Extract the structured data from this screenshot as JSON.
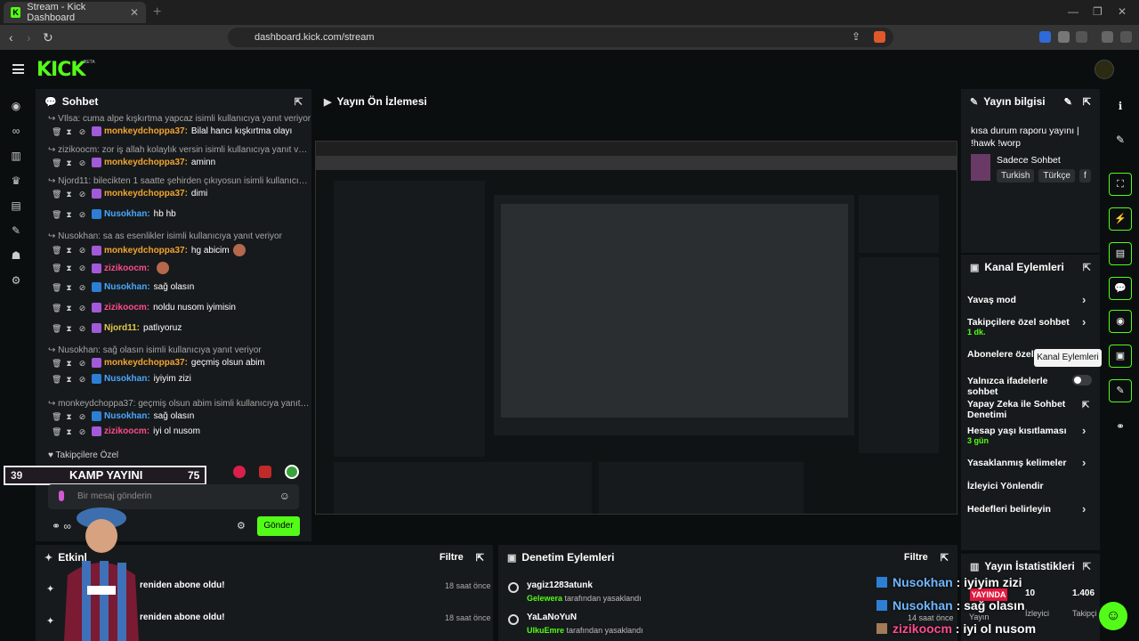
{
  "browser": {
    "tab_title": "Stream - Kick Dashboard",
    "url": "dashboard.kick.com/stream"
  },
  "app": {
    "logo": "KICK",
    "beta": "BETA"
  },
  "chat": {
    "title": "Sohbet",
    "lines": [
      {
        "reply": "VIlsa: cuma alpe kışkırtma yapcaz isimli kullanıcıya yanıt veriyor",
        "user": "monkeydchoppa37",
        "text": "Bilal hancı kışkırtma olayı",
        "color": "#f3a42f"
      },
      {
        "reply": "zizikoocm: zor iş allah kolaylık versin isimli kullanıcıya yanıt veriyor",
        "user": "monkeydchoppa37",
        "text": "aminn",
        "color": "#f3a42f"
      },
      {
        "reply": "Njord11: bilecikten 1 saatte şehirden çıkıyosun isimli kullanıcıya yanıt ...",
        "user": "monkeydchoppa37",
        "text": "dimi",
        "color": "#f3a42f"
      },
      {
        "reply": "",
        "user": "Nusokhan",
        "text": "hb hb",
        "color": "#4aa8ff"
      },
      {
        "reply": "Nusokhan: sa as esenlikler isimli kullanıcıya yanıt veriyor",
        "user": "monkeydchoppa37",
        "text": "hg abicim",
        "color": "#f3a42f"
      },
      {
        "reply": "",
        "user": "zizikoocm",
        "text": "",
        "color": "#ff4c8b"
      },
      {
        "reply": "",
        "user": "Nusokhan",
        "text": "sağ olasın",
        "color": "#4aa8ff"
      },
      {
        "reply": "",
        "user": "zizikoocm",
        "text": "noldu nusom iyimisin",
        "color": "#ff4c8b"
      },
      {
        "reply": "",
        "user": "Njord11",
        "text": "patlıyoruz",
        "color": "#e6c84a"
      },
      {
        "reply": "Nusokhan: sağ olasın isimli kullanıcıya yanıt veriyor",
        "user": "monkeydchoppa37",
        "text": "geçmiş olsun abim",
        "color": "#f3a42f"
      },
      {
        "reply": "",
        "user": "Nusokhan",
        "text": "iyiyim zizi",
        "color": "#4aa8ff"
      },
      {
        "reply": "monkeydchoppa37: geçmiş olsun abim isimli kullanıcıya yanıt veriyor",
        "user": "Nusokhan",
        "text": "sağ olasın",
        "color": "#4aa8ff"
      },
      {
        "reply": "",
        "user": "zizikoocm",
        "text": "iyi ol nusom",
        "color": "#ff4c8b"
      }
    ],
    "followers_only": "Takipçilere Özel",
    "input_placeholder": "Bir mesaj gönderin",
    "send_label": "Gönder",
    "kamp_left": "39",
    "kamp_title": "KAMP YAYINI",
    "kamp_right": "75"
  },
  "preview": {
    "title": "Yayın Ön İzlemesi"
  },
  "stream_info": {
    "title": "Yayın bilgisi",
    "stream_title": "kısa durum raporu yayını | !hawk !worp",
    "category": "Sadece Sohbet",
    "tags": [
      "Turkish",
      "Türkçe",
      "f"
    ]
  },
  "channel_actions": {
    "title": "Kanal Eylemleri",
    "items": [
      {
        "label": "Yavaş mod",
        "sub": ""
      },
      {
        "label": "Takipçilere özel sohbet",
        "sub": "1 dk."
      },
      {
        "label": "Abonelere özel s",
        "sub": ""
      },
      {
        "label": "Yalnızca ifadelerle sohbet",
        "sub": ""
      },
      {
        "label": "Yapay Zeka ile Sohbet Denetimi",
        "sub": ""
      },
      {
        "label": "Hesap yaşı kısıtlaması",
        "sub": "3 gün"
      },
      {
        "label": "Yasaklanmış kelimeler",
        "sub": ""
      },
      {
        "label": "İzleyici Yönlendir",
        "sub": ""
      },
      {
        "label": "Hedefleri belirleyin",
        "sub": ""
      }
    ],
    "tooltip": "Kanal Eylemleri"
  },
  "events": {
    "title": "Etkinl",
    "filter": "Filtre",
    "rows": [
      {
        "text": "reniden abone oldu!",
        "time": "18 saat önce"
      },
      {
        "text": "reniden abone oldu!",
        "time": "18 saat önce"
      }
    ]
  },
  "mod_actions": {
    "title": "Denetim Eylemleri",
    "filter": "Filtre",
    "rows": [
      {
        "user": "yagiz1283atunk",
        "by": "Gelewera",
        "suffix": "tarafından yasaklandı"
      },
      {
        "user": "YaLaNoYuN",
        "by": "UlkuEmre",
        "suffix": "tarafından yasaklandı"
      }
    ]
  },
  "stats": {
    "title": "Yayın İstatistikleri",
    "live": "YAYINDA",
    "live_label": "Yayın",
    "viewers": "10",
    "viewers_label": "İzleyici",
    "followers": "1.406",
    "followers_label": "Takipçi"
  },
  "overlay": {
    "lines": [
      {
        "user": "Nusokhan",
        "text": " : iyiyim zizi",
        "color": "#6fb6ff"
      },
      {
        "user": "Nusokhan",
        "text": " : sağ olasın",
        "color": "#6fb6ff"
      },
      {
        "user": "zizikoocm",
        "text": " : iyi ol nusom",
        "color": "#ff4c8b"
      }
    ],
    "time": "14 saat önce"
  },
  "colors": {
    "accent": "#53fc18",
    "panel": "#171a1c",
    "bg": "#0b0e0f"
  }
}
